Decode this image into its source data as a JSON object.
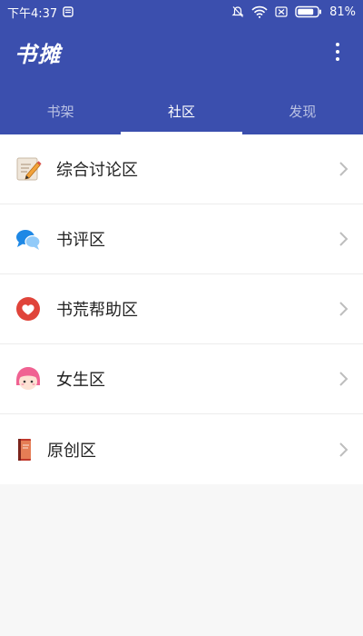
{
  "status_bar": {
    "time": "下午4:37",
    "battery": "81%"
  },
  "header": {
    "title": "书摊",
    "menu_icon": "more-vert-icon"
  },
  "tabs": [
    {
      "label": "书架",
      "active": false
    },
    {
      "label": "社区",
      "active": true
    },
    {
      "label": "发现",
      "active": false
    }
  ],
  "items": [
    {
      "label": "综合讨论区",
      "icon": "notepad-pencil-icon"
    },
    {
      "label": "书评区",
      "icon": "chat-bubbles-icon"
    },
    {
      "label": "书荒帮助区",
      "icon": "heart-icon"
    },
    {
      "label": "女生区",
      "icon": "girl-face-icon"
    },
    {
      "label": "原创区",
      "icon": "book-icon"
    }
  ],
  "colors": {
    "primary": "#3b4fae",
    "heart": "#e0443a",
    "chat": "#1e88e5",
    "girl_hair": "#f06292"
  }
}
